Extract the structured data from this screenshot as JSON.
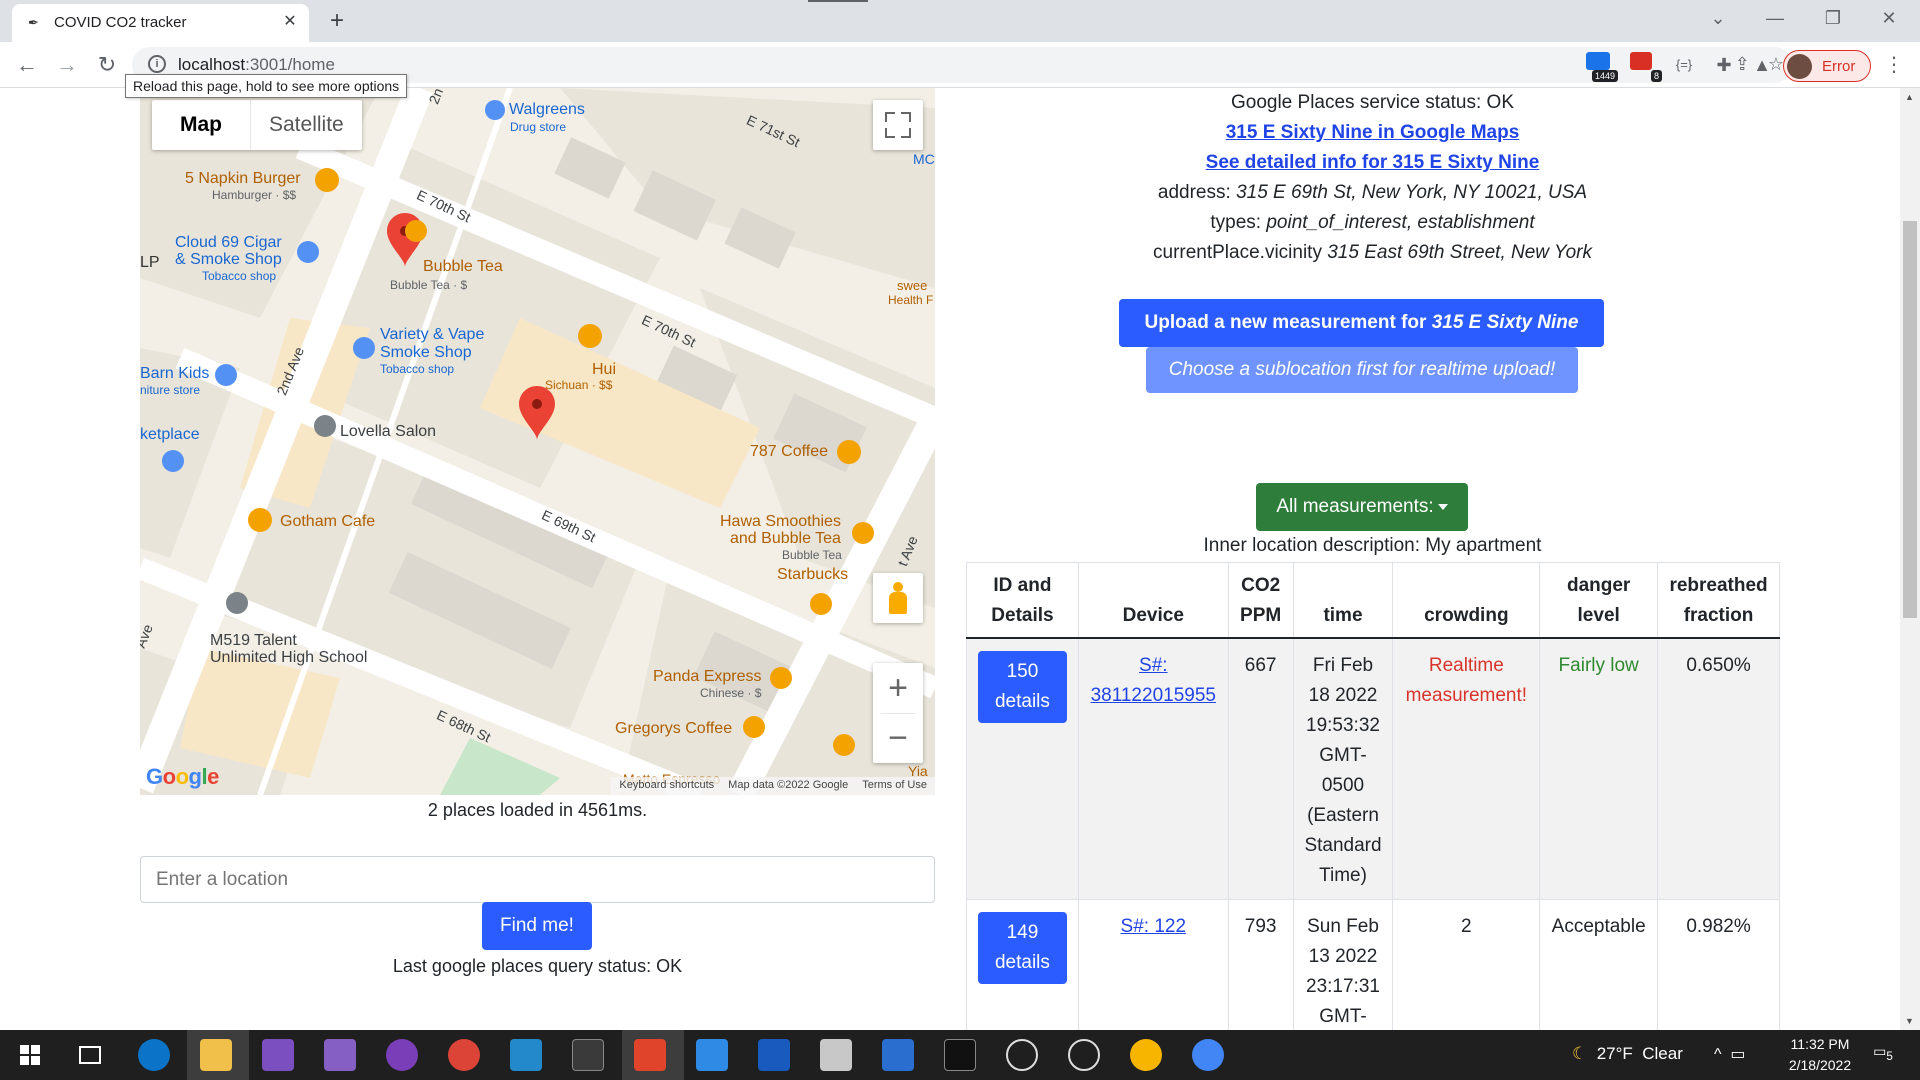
{
  "browser": {
    "tab_title": "COVID CO2 tracker",
    "url_host": "localhost",
    "url_rest": ":3001/home",
    "reload_tooltip": "Reload this page, hold to see more options",
    "ext_badge_1": "1449",
    "ext_badge_2": "8",
    "profile_status": "Error"
  },
  "map": {
    "type_map": "Map",
    "type_satellite": "Satellite",
    "google": "Google",
    "attrib_shortcuts": "Keyboard shortcuts",
    "attrib_data": "Map data ©2022 Google",
    "attrib_terms": "Terms of Use",
    "labels": {
      "walgreens": "Walgreens",
      "walgreens_sub": "Drug store",
      "napkin": "5 Napkin Burger",
      "napkin_sub": "Hamburger · $$",
      "cloud69_1": "Cloud 69 Cigar",
      "cloud69_2": "& Smoke Shop",
      "cloud69_sub": "Tobacco shop",
      "bubble": "Bubble Tea",
      "bubble_sub": "Bubble Tea · $",
      "variety_1": "Variety & Vape",
      "variety_2": "Smoke Shop",
      "variety_sub": "Tobacco shop",
      "hui": "Hui",
      "hui_sub": "Sichuan · $$",
      "barn_1": "Barn Kids",
      "barn_2": "niture store",
      "lovella": "Lovella Salon",
      "ketplace": "ketplace",
      "coffee787": "787 Coffee",
      "gotham": "Gotham Cafe",
      "hawa_1": "Hawa Smoothies",
      "hawa_2": "and Bubble Tea",
      "hawa_sub": "Bubble Tea",
      "starbucks": "Starbucks",
      "m519_1": "M519 Talent",
      "m519_2": "Unlimited High School",
      "panda": "Panda Express",
      "panda_sub": "Chinese · $",
      "gregorys": "Gregorys Coffee",
      "matto": "Matto Espresso",
      "swee": "swee",
      "health": "Health F",
      "mc": "MC",
      "yia": "Yia",
      "e71": "E 71st St",
      "e70a": "E 70th St",
      "e70b": "E 70th St",
      "e69": "E 69th St",
      "e68": "E 68th St",
      "ave2": "2nd Ave",
      "ave2b": "Ave",
      "ave2c": "2n",
      "ave3": "t Ave",
      "lp": "LP"
    }
  },
  "left": {
    "places_loaded": "2 places loaded in 4561ms.",
    "location_placeholder": "Enter a location",
    "find_button": "Find me!",
    "last_query": "Last google places query status: OK"
  },
  "right": {
    "places_status": "Google Places service status: OK",
    "maps_link": "315 E Sixty Nine in Google Maps",
    "detail_link": "See detailed info for 315 E Sixty Nine",
    "address_label": "address: ",
    "address_value": "315 E 69th St, New York, NY 10021, USA",
    "types_label": "types: ",
    "types_value": "point_of_interest, establishment",
    "vicinity_label": "currentPlace.vicinity ",
    "vicinity_value": "315 East 69th Street, New York",
    "upload_prefix": "Upload a new measurement for ",
    "upload_place": "315 E Sixty Nine",
    "choose_sublocation": "Choose a sublocation first for realtime upload!",
    "measurements_dropdown": "All measurements:",
    "inner_location": "Inner location description: My apartment"
  },
  "table": {
    "headers": [
      "ID and Details",
      "Device",
      "CO2 PPM",
      "time",
      "crowding",
      "danger level",
      "rebreathed fraction"
    ],
    "rows": [
      {
        "id": "150",
        "details": "details",
        "device": "S#: 381122015955",
        "ppm": "667",
        "time": "Fri Feb 18 2022 19:53:32 GMT-0500 (Eastern Standard Time)",
        "crowding": "Realtime measurement!",
        "danger": "Fairly low",
        "fraction": "0.650%"
      },
      {
        "id": "149",
        "details": "details",
        "device": "S#: 122",
        "ppm": "793",
        "time": "Sun Feb 13 2022 23:17:31 GMT-",
        "crowding": "2",
        "danger": "Acceptable",
        "fraction": "0.982%"
      }
    ]
  },
  "taskbar": {
    "temperature": "27°F",
    "condition": "Clear",
    "time": "11:32 PM",
    "date": "2/18/2022",
    "notifications": "5"
  }
}
